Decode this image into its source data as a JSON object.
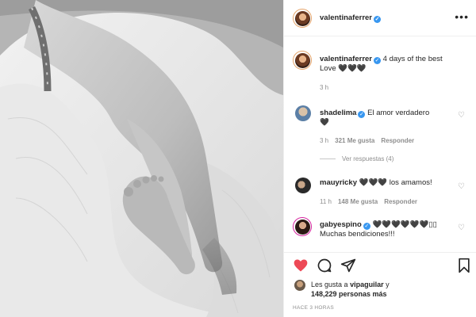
{
  "post": {
    "username": "valentinaferrer",
    "more_icon": "more-horizontal-icon"
  },
  "caption": {
    "username": "valentinaferrer",
    "text": "4 days of the best",
    "text2": "Love 🖤🖤🖤",
    "time": "3 h"
  },
  "comments": [
    {
      "username": "shadelima",
      "verified": true,
      "text": "El amor verdadero",
      "text2": "🖤",
      "time": "3 h",
      "likes": "321 Me gusta",
      "reply": "Responder",
      "replies": "Ver respuestas (4)"
    },
    {
      "username": "mauyricky",
      "verified": false,
      "text": "🖤🖤🖤 los amamos!",
      "time": "11 h",
      "likes": "148 Me gusta",
      "reply": "Responder"
    },
    {
      "username": "gabyespino",
      "verified": true,
      "text": "🖤🖤🖤🖤🖤🖤▯▯",
      "text2": "Muchas bendiciones!!!"
    }
  ],
  "likes": {
    "prefix": "Les gusta a",
    "user": "vipaguilar",
    "suffix": "y",
    "count": "148,229 personas más"
  },
  "timestamp": "HACE 3 HORAS",
  "colors": {
    "like": "#ed4956",
    "verified": "#3897f0",
    "muted": "#8e8e8e"
  }
}
